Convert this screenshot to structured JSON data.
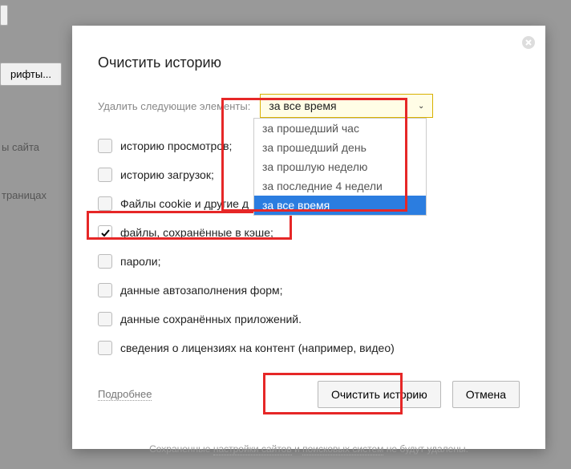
{
  "background": {
    "fonts_btn": "рифты...",
    "site_text": "ы сайта",
    "pages_text": "траницах"
  },
  "dialog": {
    "title": "Очистить историю",
    "delete_label": "Удалить следующие элементы:",
    "selected_option": "за все время",
    "options": [
      "за прошедший час",
      "за прошедший день",
      "за прошлую неделю",
      "за последние 4 недели",
      "за все время"
    ],
    "checks": [
      {
        "label": "историю просмотров;",
        "checked": false
      },
      {
        "label": "историю загрузок;",
        "checked": false
      },
      {
        "label": "Файлы cookie и другие д",
        "checked": false
      },
      {
        "label": "файлы, сохранённые в кэше;",
        "checked": true
      },
      {
        "label": "пароли;",
        "checked": false
      },
      {
        "label": "данные автозаполнения форм;",
        "checked": false
      },
      {
        "label": "данные сохранённых приложений.",
        "checked": false
      },
      {
        "label": "сведения о лицензиях на контент (например, видео)",
        "checked": false
      }
    ],
    "details_link": "Подробнее",
    "clear_btn": "Очистить историю",
    "cancel_btn": "Отмена",
    "footer_pre": "Сохраненные ",
    "footer_link1": "настройки сайтов",
    "footer_mid": " и ",
    "footer_link2": "поисковых систем",
    "footer_post": " не будут удалены."
  }
}
